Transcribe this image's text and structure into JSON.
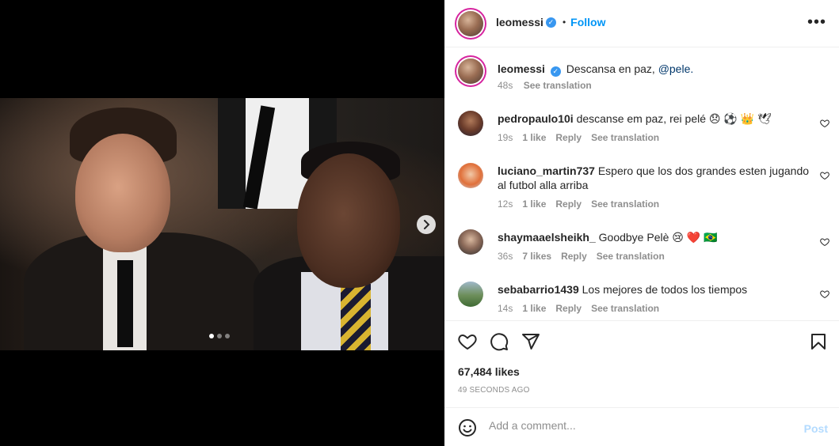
{
  "post": {
    "username": "leomessi",
    "follow_label": "Follow",
    "separator": "•",
    "more_label": "•••",
    "caption": {
      "username": "leomessi",
      "text": "Descansa en paz,",
      "mention": "@pele.",
      "age": "48s",
      "see_translation": "See translation"
    },
    "carousel": {
      "current_index": 1,
      "total": 3,
      "next_icon": "chevron-right-icon"
    }
  },
  "comments": [
    {
      "username": "pedropaulo10i",
      "text": "descanse em paz, rei pelé 😞 ⚽ 👑 🕊",
      "age": "19s",
      "likes": "1 like",
      "reply": "Reply",
      "see_translation": "See translation"
    },
    {
      "username": "luciano_martin737",
      "text": "Espero que los dos grandes esten jugando al futbol alla arriba",
      "age": "12s",
      "likes": "1 like",
      "reply": "Reply",
      "see_translation": "See translation"
    },
    {
      "username": "shaymaaelsheikh_",
      "text": "Goodbye Pelè 😢 ❤️ 🇧🇷",
      "age": "36s",
      "likes": "7 likes",
      "reply": "Reply",
      "see_translation": "See translation"
    },
    {
      "username": "sebabarrio1439",
      "text": "Los mejores de todos los tiempos",
      "age": "14s",
      "likes": "1 like",
      "reply": "Reply",
      "see_translation": "See translation"
    }
  ],
  "actions": {
    "like_icon": "heart-icon",
    "comment_icon": "comment-icon",
    "share_icon": "send-icon",
    "save_icon": "bookmark-icon",
    "likes_count": "67,484 likes",
    "timestamp": "49 SECONDS AGO"
  },
  "comment_box": {
    "emoji_icon": "smiley-icon",
    "placeholder": "Add a comment...",
    "post_label": "Post"
  },
  "colors": {
    "accent": "#0095f6",
    "verified": "#3897f0",
    "post_disabled": "#b3dbff",
    "muted": "#8e8e8e"
  }
}
